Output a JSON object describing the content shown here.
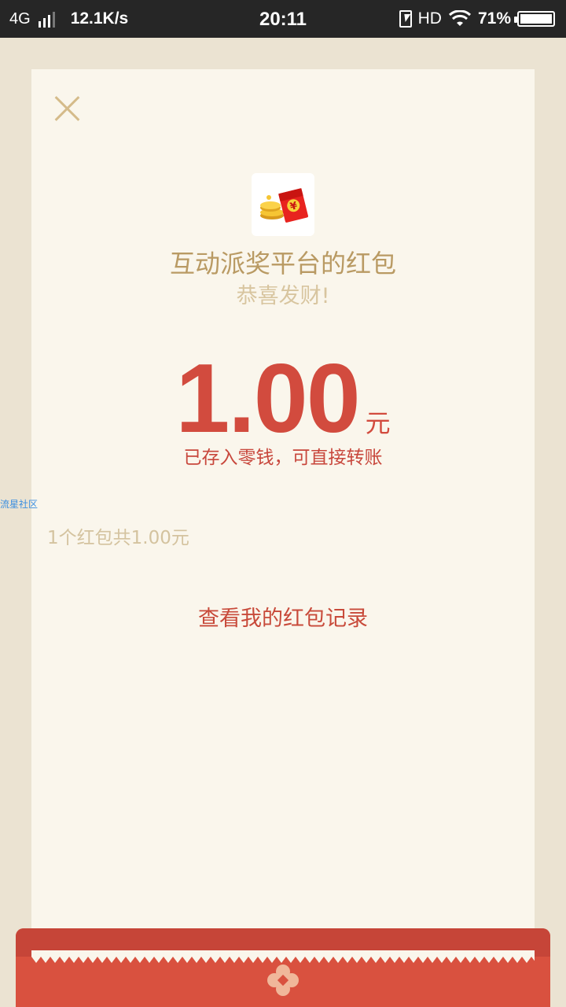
{
  "status_bar": {
    "network": "4G",
    "speed": "12.1K/s",
    "time": "20:11",
    "hd": "HD",
    "battery": "71%"
  },
  "card": {
    "sender": "互动派奖平台的红包",
    "greeting": "恭喜发财!",
    "amount": "1.00",
    "unit": "元",
    "notice": "已存入零钱，可直接转账",
    "summary": "1个红包共1.00元",
    "history_link": "查看我的红包记录"
  },
  "watermark": "流星社区",
  "icons": {
    "close": "close-icon",
    "avatar": "red-envelope-coins-icon",
    "envelope_seal": "flower-seal-icon"
  },
  "colors": {
    "background": "#ebe3d2",
    "card": "#faf6ec",
    "accent_red": "#d24b3e",
    "gold_text": "#b99a63",
    "envelope_red": "#d9513f"
  }
}
